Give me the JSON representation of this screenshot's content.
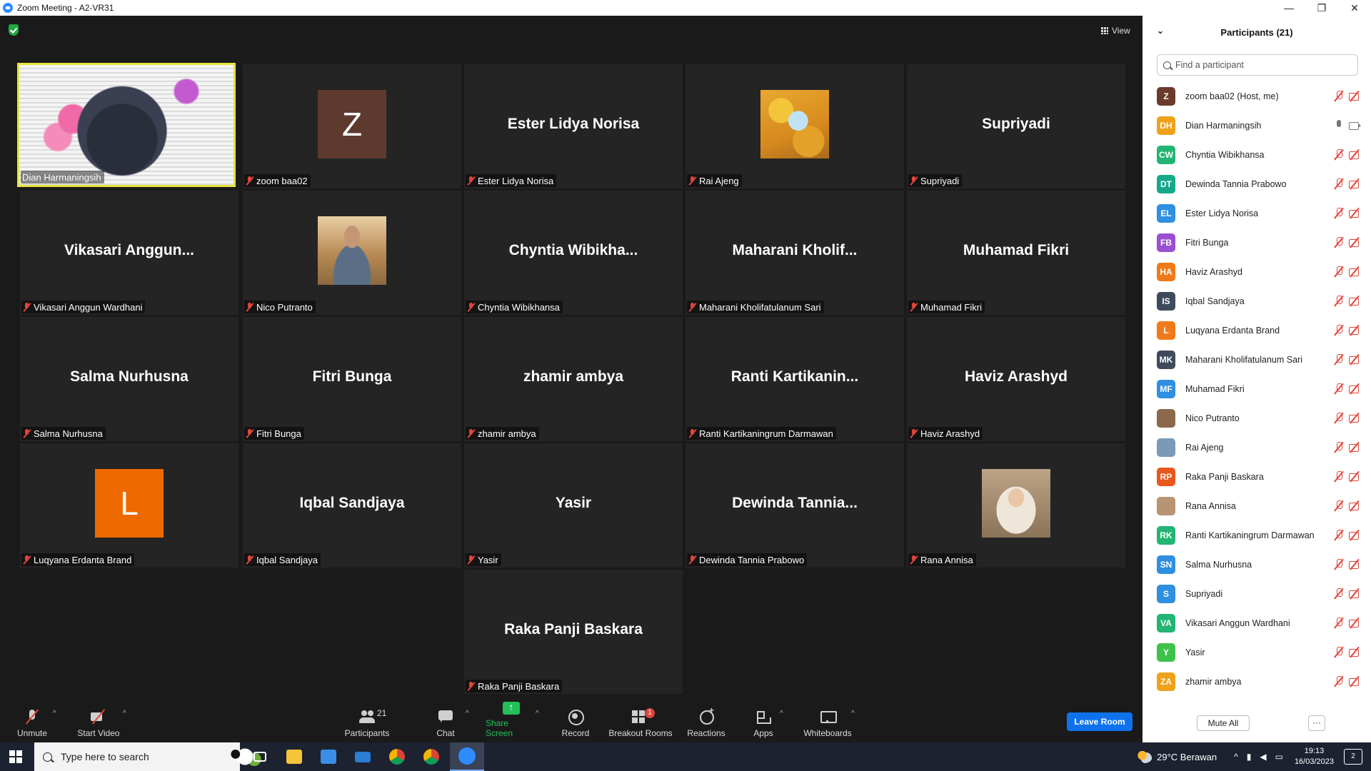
{
  "window": {
    "title": "Zoom Meeting - A2-VR31",
    "minimize": "—",
    "restore": "❐",
    "close": "✕"
  },
  "view_label": "View",
  "tiles_row1": [
    {
      "label": "Dian Harmaningsih",
      "kind": "video"
    },
    {
      "label": "zoom baa02",
      "kind": "letter",
      "letter": "Z",
      "color": "#5e3a2e"
    },
    {
      "label": "Ester Lidya Norisa",
      "kind": "name",
      "big": "Ester Lidya Norisa"
    },
    {
      "label": "Rai Ajeng",
      "kind": "photo"
    },
    {
      "label": "Supriyadi",
      "kind": "name",
      "big": "Supriyadi"
    }
  ],
  "tiles_row2": [
    {
      "label": "Vikasari Anggun Wardhani",
      "big": "Vikasari  Anggun..."
    },
    {
      "label": "Nico Putranto",
      "kind": "photo"
    },
    {
      "label": "Chyntia Wibikhansa",
      "big": "Chyntia  Wibikha..."
    },
    {
      "label": "Maharani Kholifatulanum Sari",
      "big": "Maharani  Kholif..."
    },
    {
      "label": "Muhamad Fikri",
      "big": "Muhamad Fikri"
    }
  ],
  "tiles_row3": [
    {
      "label": "Salma Nurhusna",
      "big": "Salma Nurhusna"
    },
    {
      "label": "Fitri Bunga",
      "big": "Fitri Bunga"
    },
    {
      "label": "zhamir ambya",
      "big": "zhamir ambya"
    },
    {
      "label": "Ranti Kartikaningrum Darmawan",
      "big": "Ranti  Kartikanin..."
    },
    {
      "label": "Haviz Arashyd",
      "big": "Haviz Arashyd"
    }
  ],
  "tiles_row4": [
    {
      "label": "Luqyana Erdanta Brand",
      "letter": "L",
      "color": "#ee6a00"
    },
    {
      "label": "Iqbal Sandjaya",
      "big": "Iqbal Sandjaya"
    },
    {
      "label": "Yasir",
      "big": "Yasir"
    },
    {
      "label": "Dewinda Tannia Prabowo",
      "big": "Dewinda  Tannia..."
    },
    {
      "label": "Rana Annisa",
      "kind": "photo"
    }
  ],
  "tiles_row5": [
    {
      "label": "Raka Panji Baskara",
      "big": "Raka Panji Baskara"
    }
  ],
  "toolbar": {
    "unmute": "Unmute",
    "start_video": "Start Video",
    "participants": "Participants",
    "participants_count": "21",
    "chat": "Chat",
    "share_screen": "Share Screen",
    "record": "Record",
    "breakout_rooms": "Breakout Rooms",
    "breakout_badge": "1",
    "reactions": "Reactions",
    "apps": "Apps",
    "whiteboards": "Whiteboards",
    "leave_room": "Leave Room",
    "caret": "^"
  },
  "panel": {
    "title": "Participants (21)",
    "collapse": "⌄",
    "search_placeholder": "Find a participant",
    "mute_all": "Mute All",
    "more": "···",
    "participants": [
      {
        "initials": "Z",
        "color": "#6b3a2c",
        "name": "zoom baa02 (Host, me)",
        "state": "muted"
      },
      {
        "initials": "DH",
        "color": "#f0a11a",
        "name": "Dian Harmaningsih",
        "state": "on"
      },
      {
        "initials": "CW",
        "color": "#22b573",
        "name": "Chyntia Wibikhansa",
        "state": "muted"
      },
      {
        "initials": "DT",
        "color": "#17a88c",
        "name": "Dewinda Tannia Prabowo",
        "state": "muted"
      },
      {
        "initials": "EL",
        "color": "#2f8fe0",
        "name": "Ester Lidya Norisa",
        "state": "muted"
      },
      {
        "initials": "FB",
        "color": "#9b4fd0",
        "name": "Fitri Bunga",
        "state": "muted"
      },
      {
        "initials": "HA",
        "color": "#f07a1a",
        "name": "Haviz Arashyd",
        "state": "muted"
      },
      {
        "initials": "IS",
        "color": "#3d4b5c",
        "name": "Iqbal Sandjaya",
        "state": "muted"
      },
      {
        "initials": "L",
        "color": "#f07a1a",
        "name": "Luqyana Erdanta Brand",
        "state": "muted"
      },
      {
        "initials": "MK",
        "color": "#3d4b5c",
        "name": "Maharani Kholifatulanum Sari",
        "state": "muted"
      },
      {
        "initials": "MF",
        "color": "#2f8fe0",
        "name": "Muhamad Fikri",
        "state": "muted"
      },
      {
        "initials": "",
        "color": "#8a6a4a",
        "name": "Nico Putranto",
        "state": "muted"
      },
      {
        "initials": "",
        "color": "#7a9ab8",
        "name": "Rai Ajeng",
        "state": "muted"
      },
      {
        "initials": "RP",
        "color": "#e8571e",
        "name": "Raka Panji Baskara",
        "state": "muted"
      },
      {
        "initials": "",
        "color": "#b89472",
        "name": "Rana Annisa",
        "state": "muted"
      },
      {
        "initials": "RK",
        "color": "#22b573",
        "name": "Ranti Kartikaningrum Darmawan",
        "state": "muted"
      },
      {
        "initials": "SN",
        "color": "#2f8fe0",
        "name": "Salma Nurhusna",
        "state": "muted"
      },
      {
        "initials": "S",
        "color": "#2f8fe0",
        "name": "Supriyadi",
        "state": "muted"
      },
      {
        "initials": "VA",
        "color": "#22b573",
        "name": "Vikasari Anggun Wardhani",
        "state": "muted"
      },
      {
        "initials": "Y",
        "color": "#3ec24a",
        "name": "Yasir",
        "state": "muted"
      },
      {
        "initials": "ZA",
        "color": "#f0a11a",
        "name": "zhamir ambya",
        "state": "muted"
      }
    ]
  },
  "taskbar": {
    "search_placeholder": "Type here to search",
    "weather": "29°C  Berawan",
    "time": "19:13",
    "date": "16/03/2023",
    "notifications": "2"
  },
  "colors": {
    "accent": "#0e72ed",
    "active_speaker": "#e8e23a",
    "muted_red": "#e0453b",
    "share_green": "#23c05a"
  }
}
